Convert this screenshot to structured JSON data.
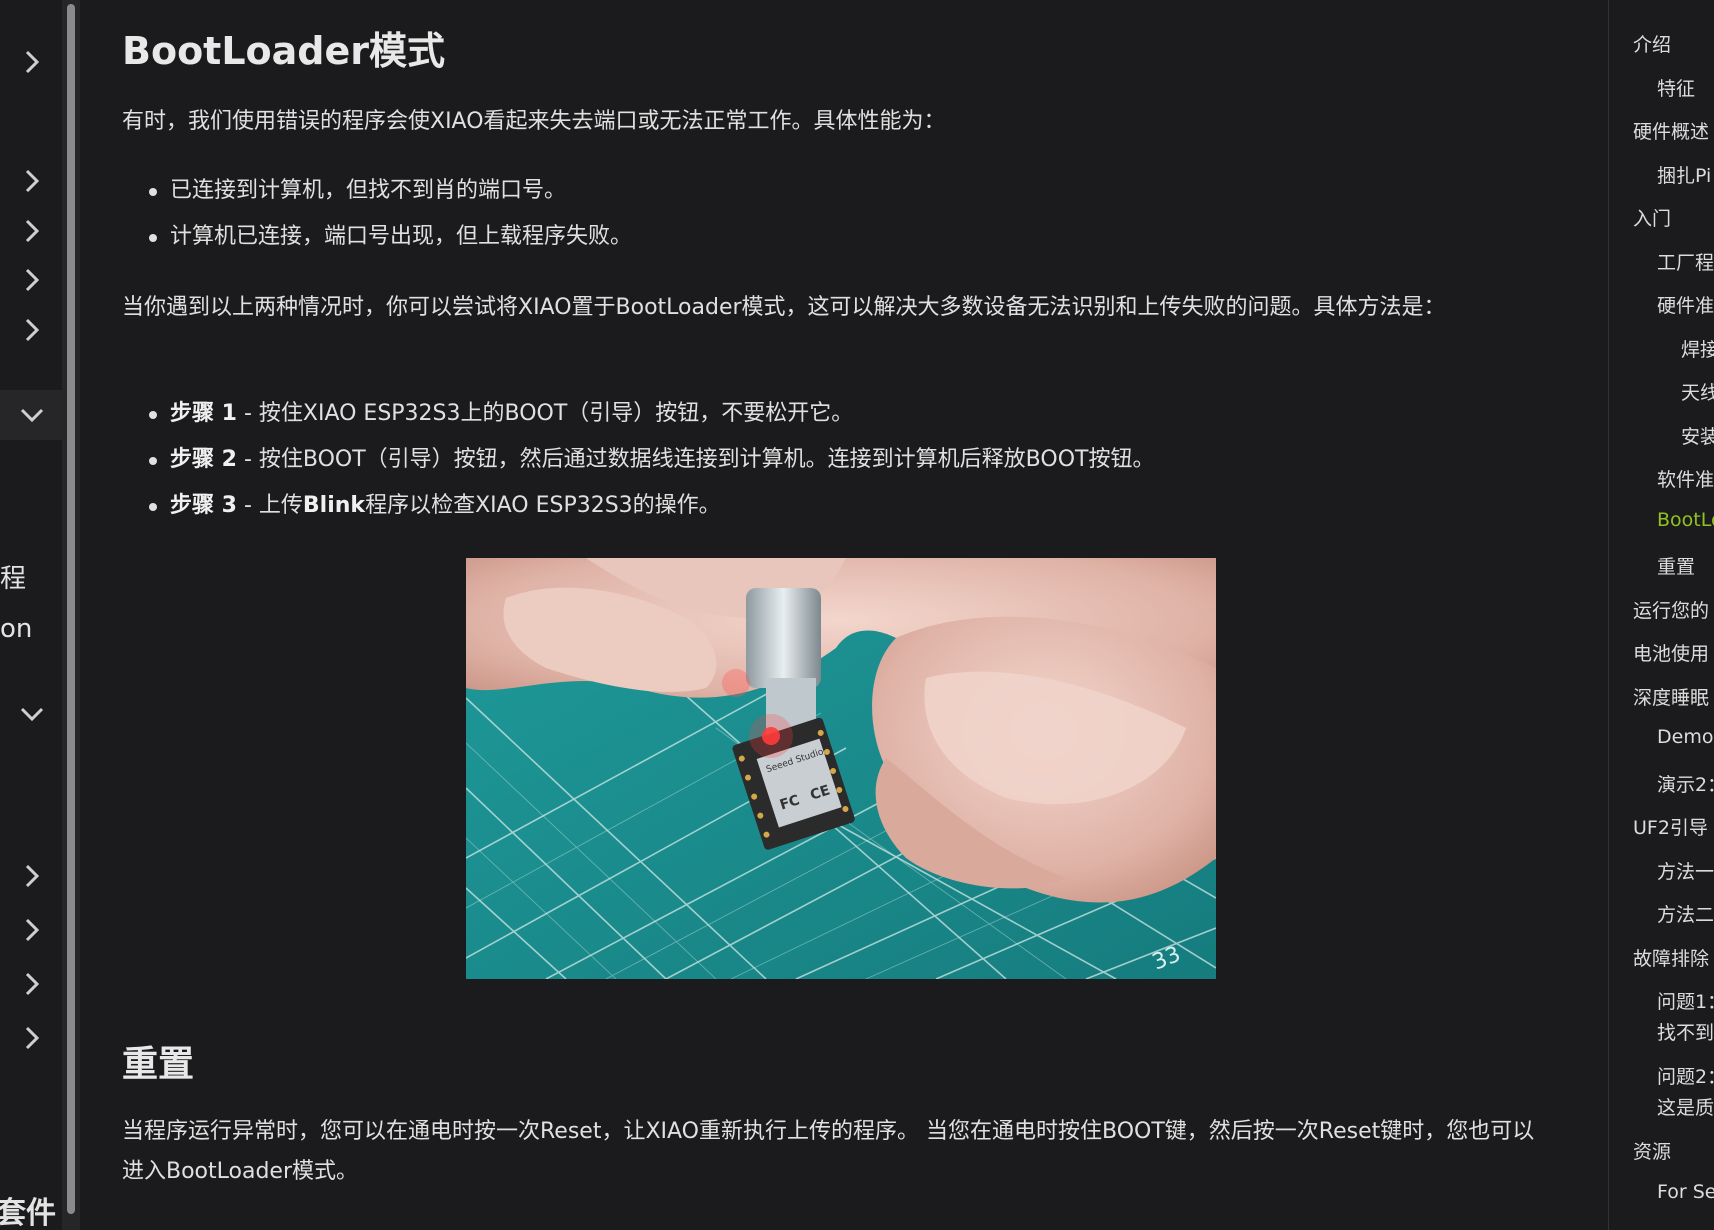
{
  "left_sidebar": {
    "partial_labels": [
      "程",
      "on",
      "套件"
    ]
  },
  "article": {
    "section1": {
      "title": "BootLoader模式",
      "intro": "有时，我们使用错误的程序会使XIAO看起来失去端口或无法正常工作。具体性能为：",
      "symptoms": [
        "已连接到计算机，但找不到肖的端口号。",
        "计算机已连接，端口号出现，但上载程序失败。"
      ],
      "advice": "当你遇到以上两种情况时，你可以尝试将XIAO置于BootLoader模式，这可以解决大多数设备无法识别和上传失败的问题。具体方法是：",
      "steps": [
        {
          "label": "步骤 1",
          "pre": " - 按住XIAO ESP32S3上的BOOT（引导）按钮，不要松开它。",
          "bold": "",
          "post": ""
        },
        {
          "label": "步骤 2",
          "pre": " - 按住BOOT（引导）按钮，然后通过数据线连接到计算机。连接到计算机后释放BOOT按钮。",
          "bold": "",
          "post": ""
        },
        {
          "label": "步骤 3",
          "pre": " - 上传",
          "bold": "Blink",
          "post": "程序以检查XIAO ESP32S3的操作。"
        }
      ],
      "image_board_text": [
        "Seeed Studio",
        "FC",
        "CE",
        "33"
      ]
    },
    "section2": {
      "title": "重置",
      "body": "当程序运行异常时，您可以在通电时按一次Reset，让XIAO重新执行上传的程序。 当您在通电时按住BOOT键，然后按一次Reset键时，您也可以进入BootLoader模式。"
    }
  },
  "toc": {
    "items": [
      {
        "label": "介绍",
        "level": 0
      },
      {
        "label": "特征",
        "level": 1
      },
      {
        "label": "硬件概述",
        "level": 0
      },
      {
        "label": "捆扎Pi",
        "level": 1
      },
      {
        "label": "入门",
        "level": 0
      },
      {
        "label": "工厂程",
        "level": 1
      },
      {
        "label": "硬件准",
        "level": 1
      },
      {
        "label": "焊接",
        "level": 2
      },
      {
        "label": "天线",
        "level": 2
      },
      {
        "label": "安装",
        "level": 2
      },
      {
        "label": "软件准",
        "level": 1
      },
      {
        "label": "BootLo",
        "level": 1,
        "active": true
      },
      {
        "label": "重置",
        "level": 1
      },
      {
        "label": "运行您的",
        "level": 0
      },
      {
        "label": "电池使用",
        "level": 0
      },
      {
        "label": "深度睡眠",
        "level": 0
      },
      {
        "label": "Demo",
        "level": 1
      },
      {
        "label": "演示2：",
        "level": 1
      },
      {
        "label": "UF2引导",
        "level": 0
      },
      {
        "label": "方法一",
        "level": 1
      },
      {
        "label": "方法二",
        "level": 1
      },
      {
        "label": "故障排除",
        "level": 0
      },
      {
        "label": "问题1：",
        "level": 1,
        "line2": "找不到"
      },
      {
        "label": "问题2：",
        "level": 1,
        "line2": "这是质"
      },
      {
        "label": "资源",
        "level": 0
      },
      {
        "label": "For Se",
        "level": 1
      }
    ],
    "active_color": "#8fc31f"
  }
}
